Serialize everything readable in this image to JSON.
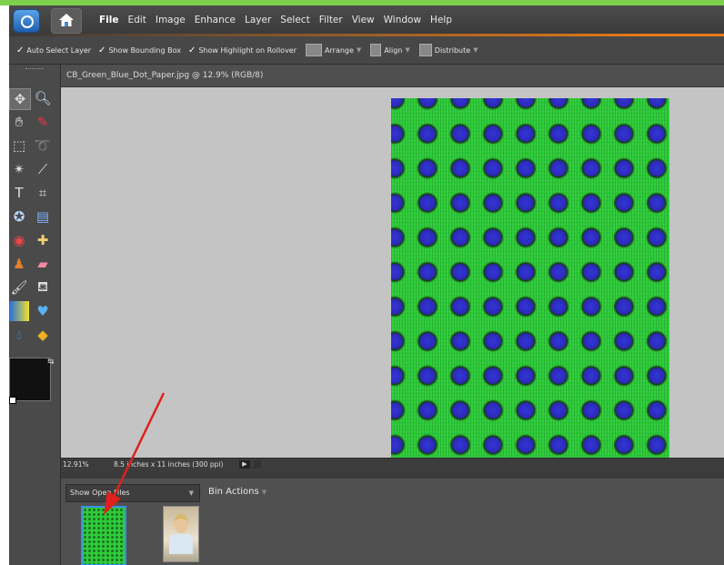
{
  "menubar": {
    "items": [
      "File",
      "Edit",
      "Image",
      "Enhance",
      "Layer",
      "Select",
      "Filter",
      "View",
      "Window",
      "Help"
    ]
  },
  "options": {
    "auto_select_layer": "Auto Select Layer",
    "show_bounding_box": "Show Bounding Box",
    "show_highlight": "Show Highlight on Rollover",
    "arrange": "Arrange",
    "align": "Align",
    "distribute": "Distribute"
  },
  "document": {
    "title": "CB_Green_Blue_Dot_Paper.jpg @ 12.9% (RGB/8)",
    "zoom": "12.91%",
    "size": "8.5 inches x 11 inches (300 ppi)"
  },
  "bin": {
    "show_select": "Show Open Files",
    "bin_actions": "Bin Actions"
  },
  "colors": {
    "accent_orange": "#e87a17",
    "paper_green": "#2ecc3a",
    "paper_blue": "#3535d8",
    "thumb_border": "#3b8ee8",
    "annotation_arrow": "#e0201c"
  }
}
